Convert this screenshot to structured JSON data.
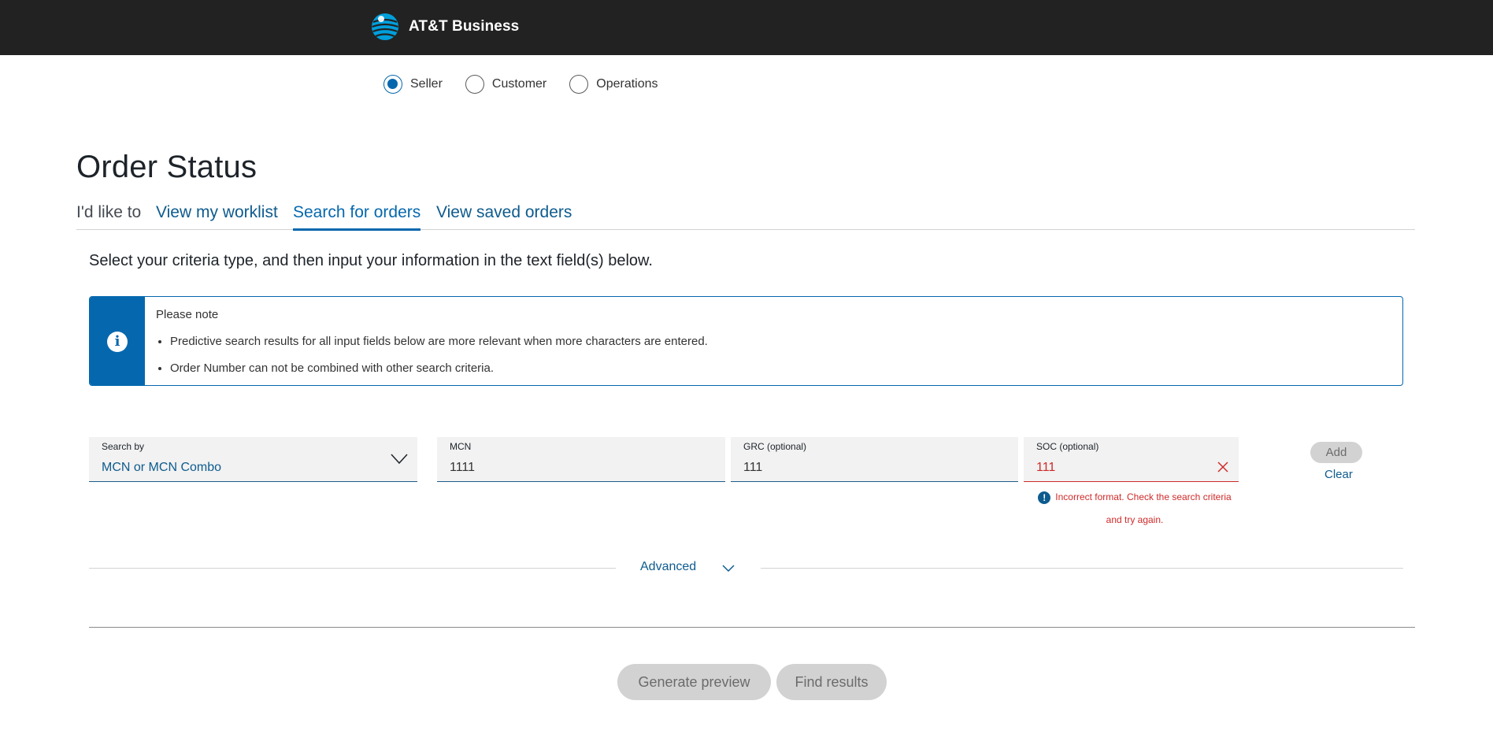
{
  "header": {
    "brand_name": "AT&T Business",
    "bg_color": "#222222",
    "logo_icon": "att-globe-icon"
  },
  "roles": [
    {
      "label": "Seller",
      "checked": true
    },
    {
      "label": "Customer",
      "checked": false
    },
    {
      "label": "Operations",
      "checked": false
    }
  ],
  "page_title": "Order Status",
  "tabs": {
    "lead": "I'd like to",
    "items": [
      {
        "label": "View my worklist",
        "active": false
      },
      {
        "label": "Search for orders",
        "active": true
      },
      {
        "label": "View saved orders",
        "active": false
      }
    ]
  },
  "instructions": "Select your criteria type, and then input your information in the text field(s) below.",
  "note": {
    "title": "Please note",
    "icon": "info-icon",
    "items": [
      "Predictive search results for all input fields below are more relevant when more characters are entered.",
      "Order Number can not be combined with other search criteria."
    ]
  },
  "search": {
    "search_by": {
      "label": "Search by",
      "value": "MCN or MCN Combo"
    },
    "mcn": {
      "label": "MCN",
      "value": "1111"
    },
    "grc": {
      "label": "GRC (optional)",
      "value": "111"
    },
    "soc": {
      "label": "SOC (optional)",
      "value": "111"
    },
    "error_message": "Incorrect format. Check the search criteria and try again.",
    "add_label": "Add",
    "clear_label": "Clear"
  },
  "advanced_label": "Advanced",
  "actions": {
    "preview_label": "Generate preview",
    "find_label": "Find results"
  },
  "colors": {
    "accent": "#0568ae",
    "error": "#cf2a2a",
    "disabled_bg": "#d2d2d2"
  }
}
